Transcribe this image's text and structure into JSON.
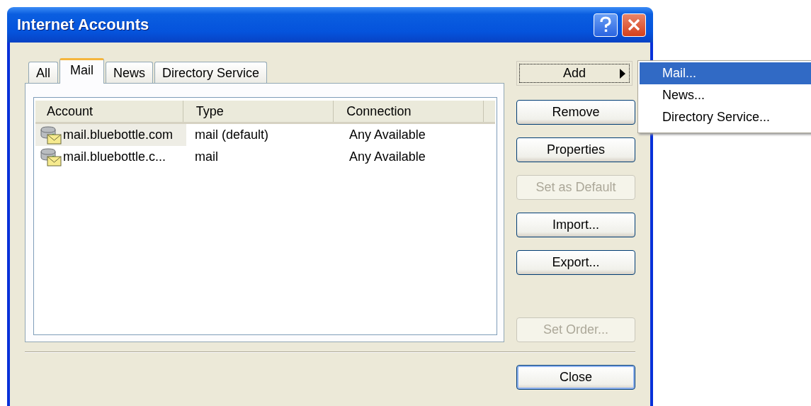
{
  "window": {
    "title": "Internet Accounts"
  },
  "tabs": [
    {
      "label": "All",
      "selected": false
    },
    {
      "label": "Mail",
      "selected": true
    },
    {
      "label": "News",
      "selected": false
    },
    {
      "label": "Directory Service",
      "selected": false
    }
  ],
  "table": {
    "columns": [
      "Account",
      "Type",
      "Connection"
    ],
    "rows": [
      {
        "account": "mail.bluebottle.com",
        "type": "mail (default)",
        "connection": "Any Available",
        "selected": true
      },
      {
        "account": "mail.bluebottle.c...",
        "type": "mail",
        "connection": "Any Available",
        "selected": false
      }
    ]
  },
  "buttons": [
    {
      "label": "Add",
      "kind": "submenu",
      "disabled": false,
      "focused": true
    },
    {
      "label": "Remove",
      "kind": "push",
      "disabled": false,
      "focused": false
    },
    {
      "label": "Properties",
      "kind": "push",
      "disabled": false,
      "focused": false
    },
    {
      "label": "Set as Default",
      "kind": "push",
      "disabled": true,
      "focused": false
    },
    {
      "label": "Import...",
      "kind": "push",
      "disabled": false,
      "focused": false
    },
    {
      "label": "Export...",
      "kind": "push",
      "disabled": false,
      "focused": false
    },
    {
      "label": "Set Order...",
      "kind": "bottom",
      "disabled": true,
      "focused": false
    }
  ],
  "add_menu": [
    {
      "label": "Mail...",
      "selected": true
    },
    {
      "label": "News...",
      "selected": false
    },
    {
      "label": "Directory Service...",
      "selected": false
    }
  ],
  "close_button": {
    "label": "Close",
    "default": true
  }
}
